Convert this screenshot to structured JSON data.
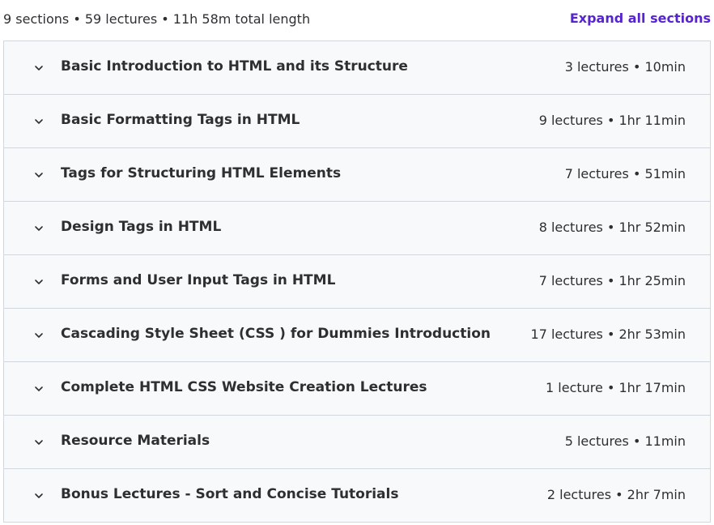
{
  "header": {
    "summary": "9 sections • 59 lectures • 11h 58m total length",
    "expand_all_label": "Expand all sections"
  },
  "colors": {
    "accent": "#5624d0",
    "section_bg": "#f7f9fa",
    "border": "#d1d7dc",
    "text": "#2d2f31"
  },
  "sections": [
    {
      "title": "Basic Introduction to HTML and its Structure",
      "meta": "3 lectures • 10min",
      "icon": "chevron-down-icon"
    },
    {
      "title": "Basic Formatting Tags in HTML",
      "meta": "9 lectures • 1hr 11min",
      "icon": "chevron-down-icon"
    },
    {
      "title": "Tags for Structuring HTML Elements",
      "meta": "7 lectures • 51min",
      "icon": "chevron-down-icon"
    },
    {
      "title": "Design Tags in HTML",
      "meta": "8 lectures • 1hr 52min",
      "icon": "chevron-down-icon"
    },
    {
      "title": "Forms and User Input Tags in HTML",
      "meta": "7 lectures • 1hr 25min",
      "icon": "chevron-down-icon"
    },
    {
      "title": "Cascading Style Sheet (CSS ) for Dummies Introduction",
      "meta": "17 lectures • 2hr 53min",
      "icon": "chevron-down-icon"
    },
    {
      "title": "Complete HTML CSS Website Creation Lectures",
      "meta": "1 lecture • 1hr 17min",
      "icon": "chevron-down-icon"
    },
    {
      "title": "Resource Materials",
      "meta": "5 lectures • 11min",
      "icon": "chevron-down-icon"
    },
    {
      "title": "Bonus Lectures - Sort and Concise Tutorials",
      "meta": "2 lectures • 2hr 7min",
      "icon": "chevron-down-icon"
    }
  ]
}
